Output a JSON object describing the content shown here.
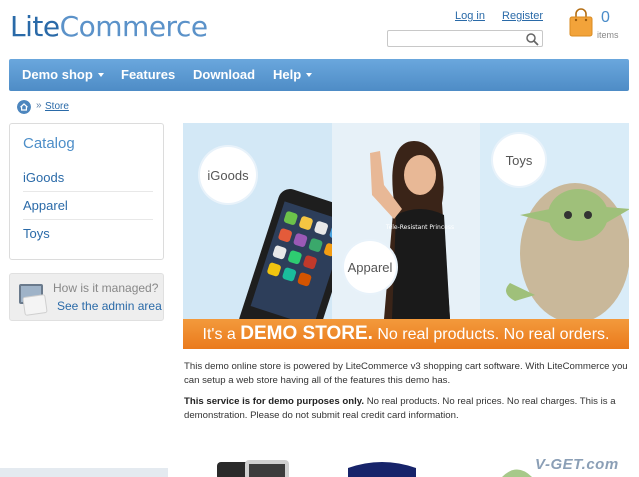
{
  "logo": {
    "part1": "Lite",
    "part2": "Commerce"
  },
  "top_links": {
    "login": "Log in",
    "register": "Register"
  },
  "search": {
    "placeholder": "",
    "icon": "search-icon"
  },
  "cart": {
    "count": "0",
    "label": "items",
    "icon": "shopping-bag-icon"
  },
  "nav": {
    "items": [
      {
        "label": "Demo shop",
        "dropdown": true
      },
      {
        "label": "Features",
        "dropdown": false
      },
      {
        "label": "Download",
        "dropdown": false
      },
      {
        "label": "Help",
        "dropdown": true
      }
    ]
  },
  "breadcrumb": {
    "separator": "»",
    "current": "Store",
    "icon": "home-icon"
  },
  "catalog": {
    "title": "Catalog",
    "items": [
      "iGoods",
      "Apparel",
      "Toys"
    ]
  },
  "admin": {
    "question": "How is it managed?",
    "link": "See the admin area",
    "icon": "admin-panel-icon"
  },
  "banner": {
    "bubbles": [
      "iGoods",
      "Apparel",
      "Toys"
    ],
    "shirt_text": "Tele-Resistant Princess",
    "strip_pre": "It's a ",
    "strip_bold": "DEMO STORE.",
    "strip_post": " No real products. No real orders."
  },
  "description": {
    "p1": "This demo online store is powered by LiteCommerce v3 shopping cart software. With LiteCommerce you can setup a web store having all of the features this demo has.",
    "p2_bold": "This service is for demo purposes only.",
    "p2_rest": " No real products. No real prices. No real charges. This is a demonstration. Please do not submit real credit card information."
  },
  "watermark": "V-GET.com",
  "colors": {
    "accent": "#4e8cc6",
    "link": "#2a6aa8",
    "banner_strip": "#f08a2a",
    "cart_bag": "#f2a33a"
  }
}
